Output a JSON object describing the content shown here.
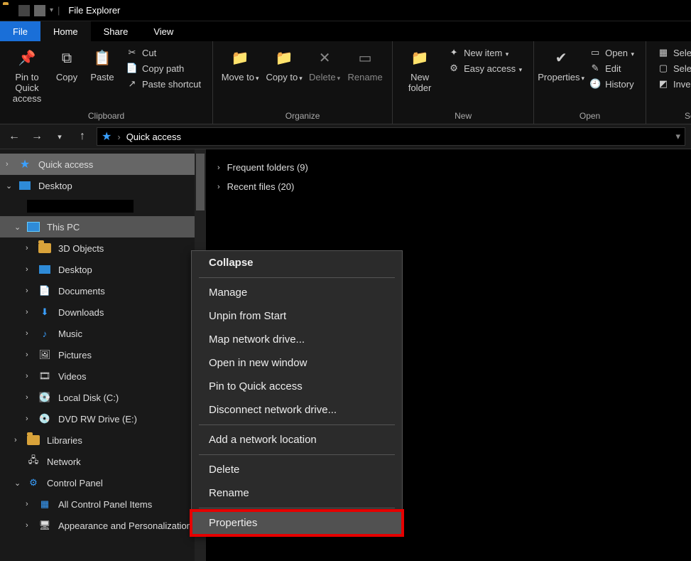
{
  "titlebar": {
    "title": "File Explorer"
  },
  "tabs": {
    "file": "File",
    "home": "Home",
    "share": "Share",
    "view": "View"
  },
  "ribbon": {
    "clipboard": {
      "label": "Clipboard",
      "pin": "Pin to Quick access",
      "copy": "Copy",
      "paste": "Paste",
      "cut": "Cut",
      "copypath": "Copy path",
      "pasteshort": "Paste shortcut"
    },
    "organize": {
      "label": "Organize",
      "moveto": "Move to",
      "copyto": "Copy to",
      "delete": "Delete",
      "rename": "Rename"
    },
    "new": {
      "label": "New",
      "newfolder": "New folder",
      "newitem": "New item",
      "easyaccess": "Easy access"
    },
    "open": {
      "label": "Open",
      "properties": "Properties",
      "open": "Open",
      "edit": "Edit",
      "history": "History"
    },
    "select": {
      "label": "Select",
      "all": "Select all",
      "none": "Select none",
      "invert": "Invert selection"
    }
  },
  "address": {
    "location": "Quick access"
  },
  "tree": {
    "quick": "Quick access",
    "desktop_root": "Desktop",
    "thispc": "This PC",
    "items": {
      "objects3d": "3D Objects",
      "desktop": "Desktop",
      "documents": "Documents",
      "downloads": "Downloads",
      "music": "Music",
      "pictures": "Pictures",
      "videos": "Videos",
      "localdisk": "Local Disk (C:)",
      "dvd": "DVD RW Drive (E:)"
    },
    "libraries": "Libraries",
    "network": "Network",
    "cpanel": "Control Panel",
    "cpanel_items": {
      "all": "All Control Panel Items",
      "appearance": "Appearance and Personalization"
    }
  },
  "content": {
    "frequent": "Frequent folders (9)",
    "recent": "Recent files (20)"
  },
  "context": {
    "collapse": "Collapse",
    "manage": "Manage",
    "unpin": "Unpin from Start",
    "mapdrive": "Map network drive...",
    "openwin": "Open in new window",
    "pinquick": "Pin to Quick access",
    "disconnect": "Disconnect network drive...",
    "addloc": "Add a network location",
    "delete": "Delete",
    "rename": "Rename",
    "properties": "Properties"
  }
}
